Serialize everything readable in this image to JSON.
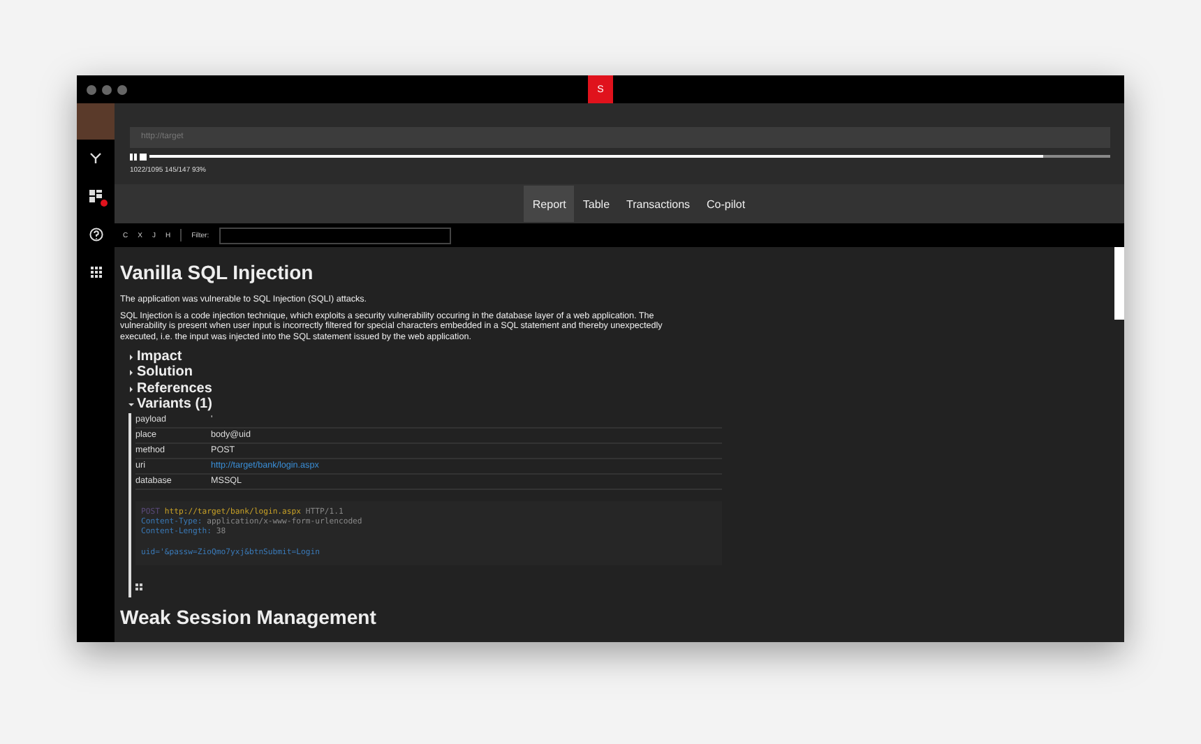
{
  "window": {
    "badge": "S"
  },
  "scan": {
    "placeholder": "http://target",
    "level": 0.93,
    "stats": "1022/1095 145/147 93%"
  },
  "tabs": [
    {
      "label": "Report",
      "selected": true
    },
    {
      "label": "Table",
      "selected": false
    },
    {
      "label": "Transactions",
      "selected": false
    },
    {
      "label": "Co-pilot",
      "selected": false
    }
  ],
  "toolbar": {
    "letters": [
      "C",
      "X",
      "J",
      "H"
    ],
    "filter_label": "Filter:"
  },
  "sidebar": {
    "items": [
      {
        "kind": "branch",
        "alert": false
      },
      {
        "kind": "dashboard",
        "alert": true
      },
      {
        "kind": "help",
        "alert": false
      },
      {
        "kind": "apps",
        "alert": false
      }
    ]
  },
  "report": {
    "title": "Vanilla SQL Injection",
    "summary": "The application was vulnerable to SQL Injection (SQLI) attacks.",
    "description": "SQL Injection is a code injection technique, which exploits a security vulnerability occuring in the database layer of a web application. The vulnerability is present when user input is incorrectly filtered for special characters embedded in a SQL statement and thereby unexpectedly executed, i.e. the input was injected into the SQL statement issued by the web application.",
    "sections": [
      {
        "label": "Impact",
        "expanded": false
      },
      {
        "label": "Solution",
        "expanded": false
      },
      {
        "label": "References",
        "expanded": false
      },
      {
        "label": "Variants (1)",
        "expanded": true
      }
    ],
    "variant": [
      {
        "key": "payload",
        "value": "'",
        "kind": "text"
      },
      {
        "key": "place",
        "value": "body@uid",
        "kind": "text"
      },
      {
        "key": "method",
        "value": "POST",
        "kind": "text"
      },
      {
        "key": "uri",
        "value": "http://target/bank/login.aspx",
        "kind": "link"
      },
      {
        "key": "database",
        "value": "MSSQL",
        "kind": "text"
      }
    ],
    "request": {
      "method": "POST",
      "url": "http://target/bank/login.aspx",
      "protocol": "HTTP/1.1",
      "headers": [
        {
          "name": "Content-Type:",
          "value": "application/x-www-form-urlencoded"
        },
        {
          "name": "Content-Length:",
          "value": "38"
        }
      ],
      "body": "uid='&passw=ZioQmo7yxj&btnSubmit=Login"
    },
    "next_title": "Weak Session Management"
  }
}
